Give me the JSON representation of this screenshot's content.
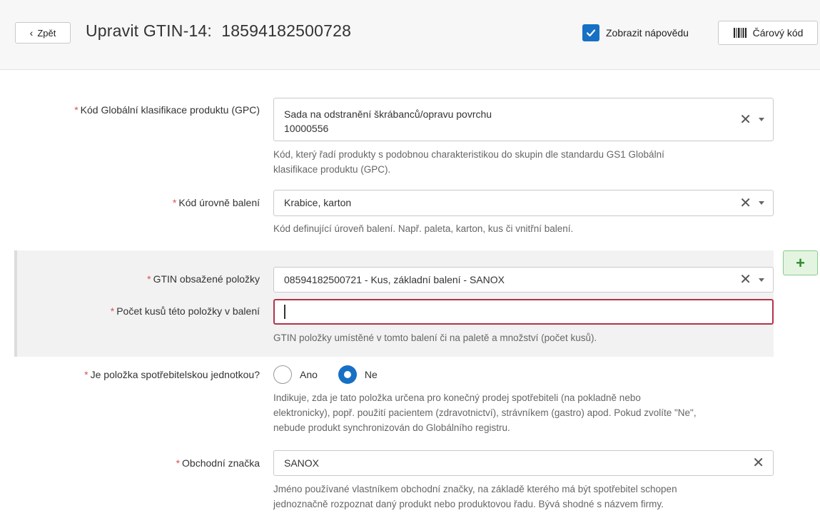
{
  "header": {
    "back_label": "Zpět",
    "title": "Upravit GTIN-14:",
    "gtin": "18594182500728",
    "help_label": "Zobrazit nápovědu",
    "help_checked": true,
    "barcode_label": "Čárový kód"
  },
  "fields": {
    "required_mark": "*",
    "gpc": {
      "label": "Kód Globální klasifikace produktu (GPC)",
      "value_line1": "Sada na odstranění škrábanců/opravu povrchu",
      "value_line2": "10000556",
      "hint_line1": "Kód, který řadí produkty s podobnou charakteristikou do skupin dle standardu GS1 Globální",
      "hint_line2": "klasifikace produktu (GPC)."
    },
    "packaging_level": {
      "label": "Kód úrovně balení",
      "value": "Krabice, karton",
      "hint": "Kód definující úroveň balení. Např. paleta, karton, kus či vnitřní balení."
    },
    "contained_gtin": {
      "label": "GTIN obsažené položky",
      "value": "08594182500721 - Kus, základní balení - SANOX"
    },
    "quantity": {
      "label": "Počet kusů této položky v balení",
      "value": "",
      "hint": "GTIN položky umístěné v tomto balení či na paletě a množství (počet kusů)."
    },
    "consumer_unit": {
      "label": "Je položka spotřebitelskou jednotkou?",
      "options": [
        "Ano",
        "Ne"
      ],
      "selected": "Ne",
      "hint_line1": "Indikuje, zda je tato položka určena pro konečný prodej spotřebiteli (na pokladně nebo",
      "hint_line2": "elektronicky), popř. použití pacientem (zdravotnictví), strávníkem (gastro) apod. Pokud zvolíte \"Ne\",",
      "hint_line3": "nebude produkt synchronizován do Globálního registru."
    },
    "brand": {
      "label": "Obchodní značka",
      "value": "SANOX",
      "hint_line1": "Jméno používané vlastníkem obchodní značky, na základě kterého má být spotřebitel schopen",
      "hint_line2": "jednoznačně rozpoznat daný produkt nebo produktovou řadu. Bývá shodné s názvem firmy."
    }
  },
  "add_button_label": "+",
  "icons": {
    "back": "chevron-left-icon",
    "check": "check-icon",
    "barcode": "barcode-icon",
    "clear": "close-icon",
    "dropdown": "chevron-down-icon",
    "add": "plus-icon"
  },
  "colors": {
    "accent": "#1670c4",
    "required": "#d9534f",
    "error_border": "#b3324a",
    "add_green": "#2e8b2e"
  }
}
